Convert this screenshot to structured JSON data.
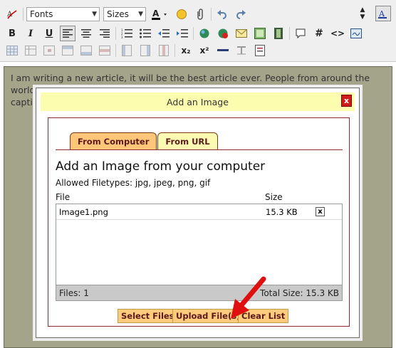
{
  "toolbar": {
    "fonts_label": "Fonts",
    "sizes_label": "Sizes",
    "row1_icons": [
      "spellcheck-icon"
    ],
    "row1_icons_after": [
      "text-color-icon",
      "emoticon-icon",
      "attachment-icon",
      "undo-icon",
      "redo-icon"
    ],
    "row2_icons": [
      "bold-icon",
      "italic-icon",
      "underline-icon",
      "align-left-icon",
      "align-center-icon",
      "align-right-icon",
      "ordered-list-icon",
      "unordered-list-icon",
      "outdent-icon",
      "indent-icon",
      "insert-link-icon",
      "remove-link-icon",
      "email-link-icon",
      "insert-image-icon",
      "insert-media-icon",
      "comment-icon",
      "anchor-icon",
      "html-source-icon",
      "special-object-icon"
    ],
    "bold_glyph": "B",
    "italic_glyph": "I",
    "underline_glyph": "U",
    "anchor_glyph": "#",
    "source_glyph": "<>",
    "subscript_glyph": "x₂",
    "superscript_glyph": "x²"
  },
  "editor": {
    "text": "I am writing a new article, it will be the best article ever.  People from around the world will rave about how amazing this article is.  It will contain images, with captions..."
  },
  "dialog": {
    "title": "Add an Image",
    "close_label": "x",
    "tabs": [
      {
        "label": "From Computer",
        "active": true
      },
      {
        "label": "From URL",
        "active": false
      }
    ],
    "heading": "Add an Image from your computer",
    "allowed_filetypes": "Allowed Filetypes: jpg, jpeg, png, gif",
    "columns": {
      "file": "File",
      "size": "Size"
    },
    "files": [
      {
        "name": "Image1.png",
        "size": "15.3 KB",
        "remove_label": "x"
      }
    ],
    "files_count": "Files: 1",
    "total_size": "Total Size: 15.3 KB",
    "buttons": {
      "select": "Select Files",
      "upload": "Upload File(s)",
      "clear": "Clear List"
    }
  },
  "colors": {
    "title_bar": "#fdfdb0",
    "active_tab": "#ffc67a",
    "inactive_tab": "#fdfbb3",
    "button": "#fdcb7c",
    "panel_border": "#8b2b2b",
    "close_button": "#d11b1b",
    "editor_bg": "#a3a48a",
    "arrow": "#e01010"
  }
}
